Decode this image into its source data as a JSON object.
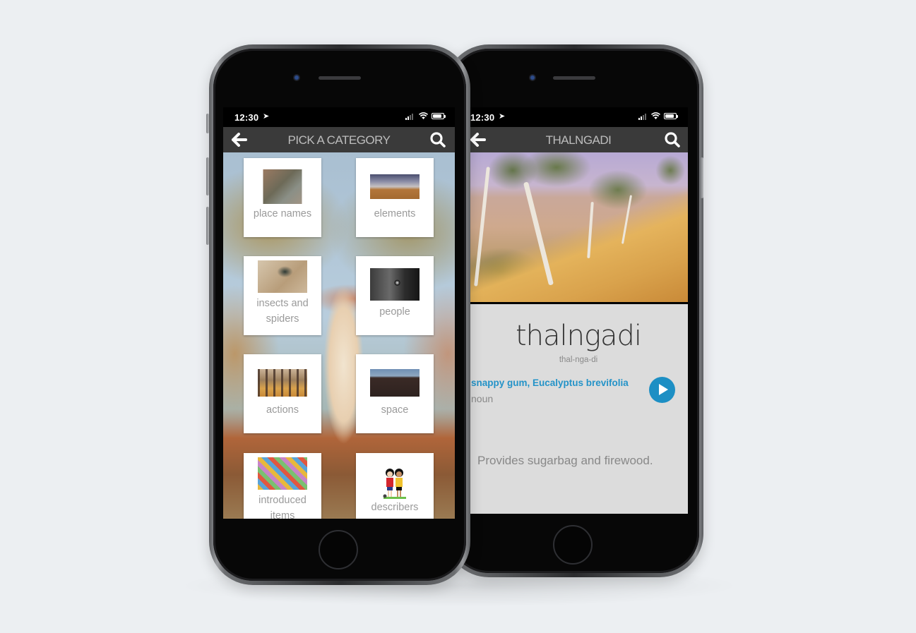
{
  "left_phone": {
    "status": {
      "time": "12:30",
      "location_icon": "location-arrow-icon"
    },
    "navbar": {
      "title": "PICK A CATEGORY",
      "back_icon": "arrow-left-icon",
      "search_icon": "search-icon"
    },
    "categories": [
      {
        "label": "place names",
        "thumb": "aerial-landscape-photo"
      },
      {
        "label": "elements",
        "thumb": "sky-clouds-photo"
      },
      {
        "label": "insects and spiders",
        "thumb": "ant-photo"
      },
      {
        "label": "people",
        "thumb": "child-face-photo"
      },
      {
        "label": "actions",
        "thumb": "dancers-photo"
      },
      {
        "label": "space",
        "thumb": "hill-photo"
      },
      {
        "label": "introduced items",
        "thumb": "banknotes-photo"
      },
      {
        "label": "describers",
        "thumb": "two-kids-illustration"
      }
    ]
  },
  "right_phone": {
    "status": {
      "time": "12:30",
      "location_icon": "location-arrow-icon"
    },
    "navbar": {
      "title": "THALNGADI",
      "back_icon": "arrow-left-icon",
      "search_icon": "search-icon"
    },
    "entry": {
      "word": "thalngadi",
      "pronunciation": "thal-nga-di",
      "gloss": "snappy gum, Eucalyptus brevifolia",
      "part_of_speech": "noun",
      "description": "Provides sugarbag and firewood.",
      "play_icon": "play-icon"
    },
    "colors": {
      "accent": "#1d8fc4",
      "navbar": "#3a3a3a",
      "card_bg": "#dcdcdc"
    }
  }
}
